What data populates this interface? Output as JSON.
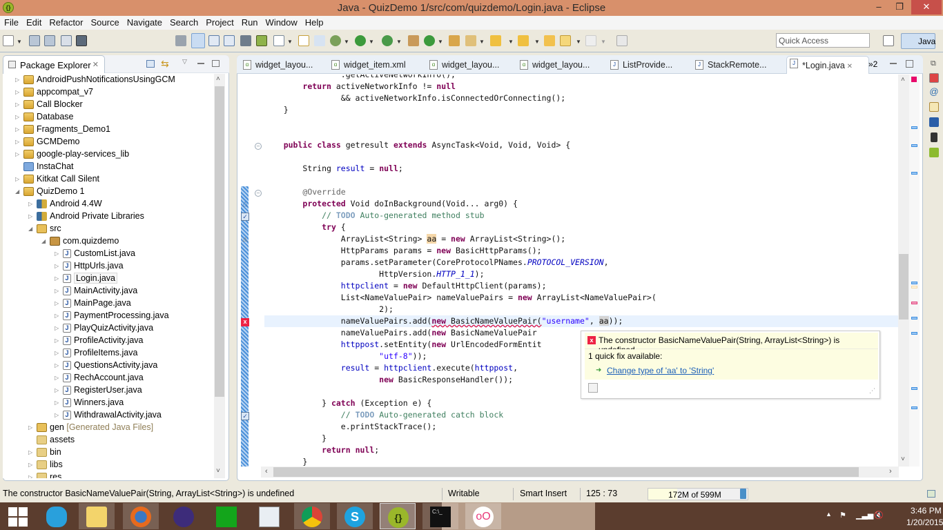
{
  "window": {
    "title": "Java - QuizDemo 1/src/com/quizdemo/Login.java - Eclipse",
    "minimize": "–",
    "restore": "❐",
    "close": "✕"
  },
  "menu": [
    "File",
    "Edit",
    "Refactor",
    "Source",
    "Navigate",
    "Search",
    "Project",
    "Run",
    "Window",
    "Help"
  ],
  "toolbar": {
    "icons": [
      "new-wizard-icon",
      "save-icon",
      "save-all-icon",
      "print-icon",
      "android-virtual-device-icon",
      "open-type-hierarchy-icon",
      "toggle-mark-occurrences-icon",
      "toggle-block-selection-icon",
      "show-whitespace-icon",
      "android-sdk-manager-icon",
      "android-avd-manager-icon",
      "run-lint-icon",
      "new-android-project-icon",
      "skip-breakpoints-icon",
      "debug-icon",
      "run-icon",
      "external-tools-icon",
      "new-java-package-icon",
      "new-java-class-icon",
      "open-type-icon",
      "search-icon",
      "next-annotation-icon",
      "previous-annotation-icon",
      "last-edit-location-icon",
      "back-icon",
      "forward-icon",
      "pin-editor-icon"
    ],
    "quick_access_placeholder": "Quick Access",
    "perspective": "Java"
  },
  "package_explorer": {
    "title": "Package Explorer",
    "tree": [
      {
        "label": "AndroidPushNotificationsUsingGCM",
        "level": 0,
        "icon": "project",
        "twisty": "collapsed"
      },
      {
        "label": "appcompat_v7",
        "level": 0,
        "icon": "project",
        "twisty": "collapsed"
      },
      {
        "label": "Call Blocker",
        "level": 0,
        "icon": "project",
        "twisty": "collapsed"
      },
      {
        "label": "Database",
        "level": 0,
        "icon": "project",
        "twisty": "collapsed"
      },
      {
        "label": "Fragments_Demo1",
        "level": 0,
        "icon": "project",
        "twisty": "collapsed"
      },
      {
        "label": "GCMDemo",
        "level": 0,
        "icon": "project",
        "twisty": "collapsed"
      },
      {
        "label": "google-play-services_lib",
        "level": 0,
        "icon": "project",
        "twisty": "collapsed"
      },
      {
        "label": "InstaChat",
        "level": 0,
        "icon": "closed-project",
        "twisty": "none"
      },
      {
        "label": "Kitkat Call Silent",
        "level": 0,
        "icon": "project",
        "twisty": "collapsed"
      },
      {
        "label": "QuizDemo 1",
        "level": 0,
        "icon": "project",
        "twisty": "expanded"
      },
      {
        "label": "Android 4.4W",
        "level": 1,
        "icon": "library",
        "twisty": "collapsed"
      },
      {
        "label": "Android Private Libraries",
        "level": 1,
        "icon": "library",
        "twisty": "collapsed"
      },
      {
        "label": "src",
        "level": 1,
        "icon": "source-folder",
        "twisty": "expanded"
      },
      {
        "label": "com.quizdemo",
        "level": 2,
        "icon": "package",
        "twisty": "expanded"
      },
      {
        "label": "CustomList.java",
        "level": 3,
        "icon": "java",
        "twisty": "collapsed"
      },
      {
        "label": "HttpUrls.java",
        "level": 3,
        "icon": "java",
        "twisty": "collapsed"
      },
      {
        "label": "Login.java",
        "level": 3,
        "icon": "java",
        "twisty": "collapsed",
        "selected": true
      },
      {
        "label": "MainActivity.java",
        "level": 3,
        "icon": "java",
        "twisty": "collapsed"
      },
      {
        "label": "MainPage.java",
        "level": 3,
        "icon": "java",
        "twisty": "collapsed"
      },
      {
        "label": "PaymentProcessing.java",
        "level": 3,
        "icon": "java",
        "twisty": "collapsed"
      },
      {
        "label": "PlayQuizActivity.java",
        "level": 3,
        "icon": "java",
        "twisty": "collapsed"
      },
      {
        "label": "ProfileActivity.java",
        "level": 3,
        "icon": "java",
        "twisty": "collapsed"
      },
      {
        "label": "ProfileItems.java",
        "level": 3,
        "icon": "java",
        "twisty": "collapsed"
      },
      {
        "label": "QuestionsActivity.java",
        "level": 3,
        "icon": "java",
        "twisty": "collapsed"
      },
      {
        "label": "RechAccount.java",
        "level": 3,
        "icon": "java",
        "twisty": "collapsed"
      },
      {
        "label": "RegisterUser.java",
        "level": 3,
        "icon": "java",
        "twisty": "collapsed"
      },
      {
        "label": "Winners.java",
        "level": 3,
        "icon": "java",
        "twisty": "collapsed"
      },
      {
        "label": "WithdrawalActivity.java",
        "level": 3,
        "icon": "java",
        "twisty": "collapsed"
      },
      {
        "label": "gen",
        "suffix": "[Generated Java Files]",
        "level": 1,
        "icon": "source-folder",
        "twisty": "collapsed"
      },
      {
        "label": "assets",
        "level": 1,
        "icon": "folder",
        "twisty": "none"
      },
      {
        "label": "bin",
        "level": 1,
        "icon": "folder",
        "twisty": "collapsed"
      },
      {
        "label": "libs",
        "level": 1,
        "icon": "folder",
        "twisty": "collapsed"
      },
      {
        "label": "res",
        "level": 1,
        "icon": "folder",
        "twisty": "collapsed"
      }
    ]
  },
  "editor": {
    "tabs": [
      {
        "label": "widget_layou...",
        "icon": "xml"
      },
      {
        "label": "widget_item.xml",
        "icon": "xml"
      },
      {
        "label": "widget_layou...",
        "icon": "xml"
      },
      {
        "label": "widget_layou...",
        "icon": "xml"
      },
      {
        "label": "ListProvide...",
        "icon": "java-warning"
      },
      {
        "label": "StackRemote...",
        "icon": "java-warning"
      },
      {
        "label": "*Login.java",
        "icon": "java-warning",
        "active": true
      }
    ],
    "overflow_label": "»2",
    "code_lines": [
      "                .getActiveNetworkInfo();",
      "        return activeNetworkInfo != null",
      "                && activeNetworkInfo.isConnectedOrConnecting();",
      "    }",
      "",
      "",
      "    public class getresult extends AsyncTask<Void, Void, Void> {",
      "",
      "        String result = null;",
      "",
      "        @Override",
      "        protected Void doInBackground(Void... arg0) {",
      "            // TODO Auto-generated method stub",
      "            try {",
      "                ArrayList<String> aa = new ArrayList<String>();",
      "                HttpParams params = new BasicHttpParams();",
      "                params.setParameter(CoreProtocolPNames.PROTOCOL_VERSION,",
      "                        HttpVersion.HTTP_1_1);",
      "                httpclient = new DefaultHttpClient(params);",
      "                List<NameValuePair> nameValuePairs = new ArrayList<NameValuePair>(",
      "                        2);",
      "                nameValuePairs.add(new BasicNameValuePair(\"username\", aa));",
      "                nameValuePairs.add(new BasicNameValuePair",
      "                httppost.setEntity(new UrlEncodedFormEntit",
      "                        \"utf-8\"));",
      "                result = httpclient.execute(httppost,",
      "                        new BasicResponseHandler());",
      "",
      "            } catch (Exception e) {",
      "                // TODO Auto-generated catch block",
      "                e.printStackTrace();",
      "            }",
      "            return null;",
      "        }"
    ],
    "hover": {
      "message": "The constructor BasicNameValuePair(String, ArrayList<String>) is undefined",
      "quick_fix_count": "1 quick fix available:",
      "fix_label": "Change type of 'aa' to 'String'"
    }
  },
  "status": {
    "message": "The constructor BasicNameValuePair(String, ArrayList<String>) is undefined",
    "writable": "Writable",
    "insert_mode": "Smart Insert",
    "position": "125 : 73",
    "heap": "172M of 599M",
    "heap_used_fraction": 0.29
  },
  "taskbar": {
    "apps": [
      "start",
      "internet-explorer",
      "file-explorer",
      "firefox",
      "eclipse",
      "windows-store",
      "remote-desktop",
      "chrome",
      "skype",
      "eclipse-quizdemo",
      "command-prompt",
      "flickr"
    ],
    "time": "3:46 PM",
    "date": "1/20/2015"
  }
}
